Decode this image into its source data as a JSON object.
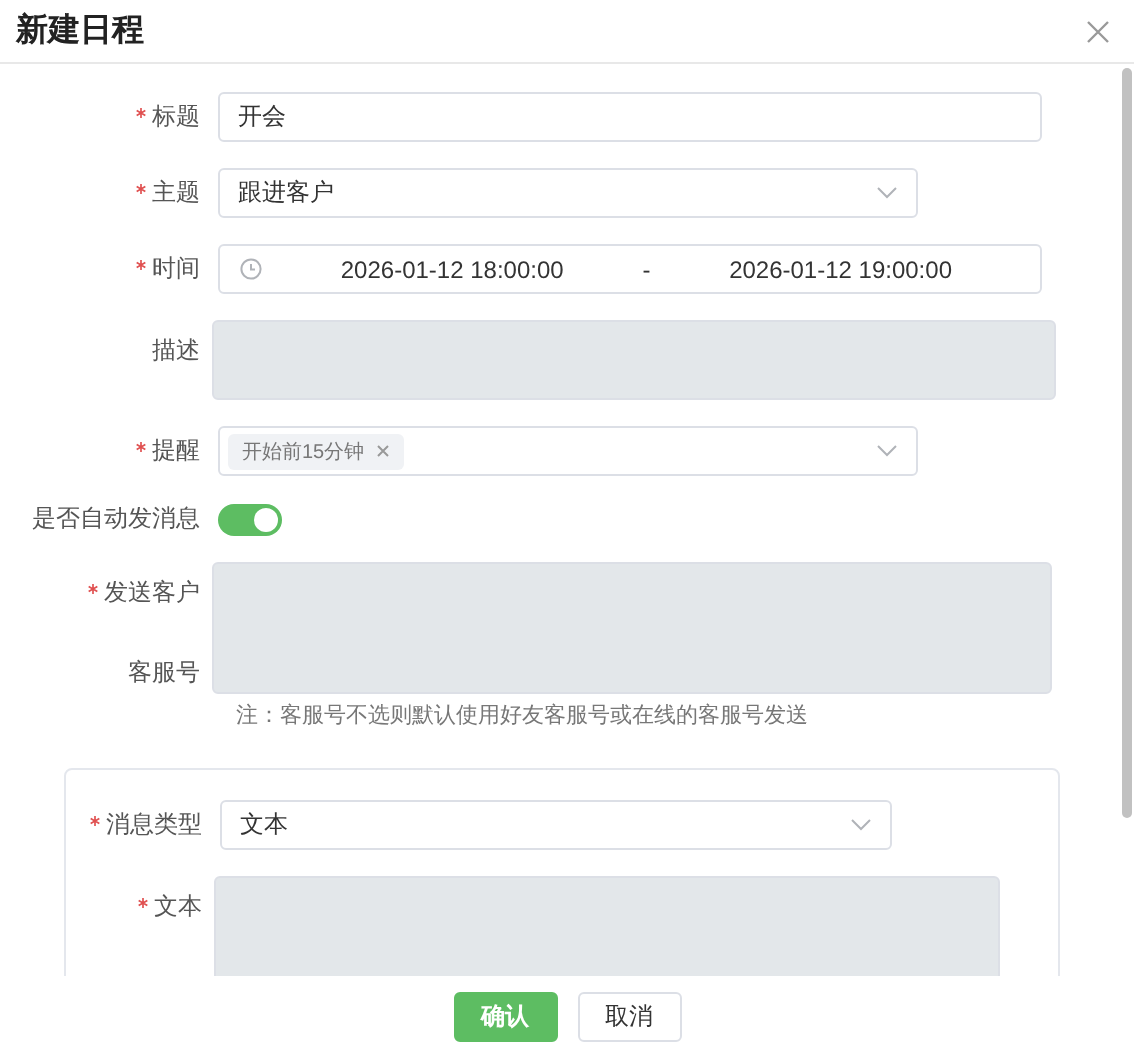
{
  "dialog": {
    "title": "新建日程"
  },
  "fields": [
    {
      "kind": "input",
      "label": "标题",
      "required": true,
      "value": "开会"
    },
    {
      "kind": "select",
      "label": "主题",
      "required": true,
      "value": "跟进客户"
    },
    {
      "kind": "daterange",
      "label": "时间",
      "required": true,
      "start": "2026-01-12 18:00:00",
      "separator": "-",
      "end": "2026-01-12 19:00:00"
    },
    {
      "kind": "textarea",
      "label": "描述",
      "required": false
    },
    {
      "kind": "tags",
      "label": "提醒",
      "required": true,
      "tags": [
        "开始前15分钟"
      ]
    },
    {
      "kind": "switch",
      "label": "是否自动发消息",
      "required": false,
      "on": true
    },
    {
      "kind": "block",
      "labels": [
        {
          "text": "发送客户",
          "required": true
        },
        {
          "text": "客服号",
          "required": false
        }
      ],
      "note": "注：客服号不选则默认使用好友客服号或在线的客服号发送"
    }
  ],
  "message_card": {
    "fields": [
      {
        "kind": "select",
        "label": "消息类型",
        "required": true,
        "value": "文本"
      },
      {
        "kind": "textarea",
        "label": "文本",
        "required": true
      }
    ]
  },
  "buttons": [
    {
      "label": "确认",
      "kind": "primary"
    },
    {
      "label": "取消",
      "kind": "default"
    }
  ]
}
